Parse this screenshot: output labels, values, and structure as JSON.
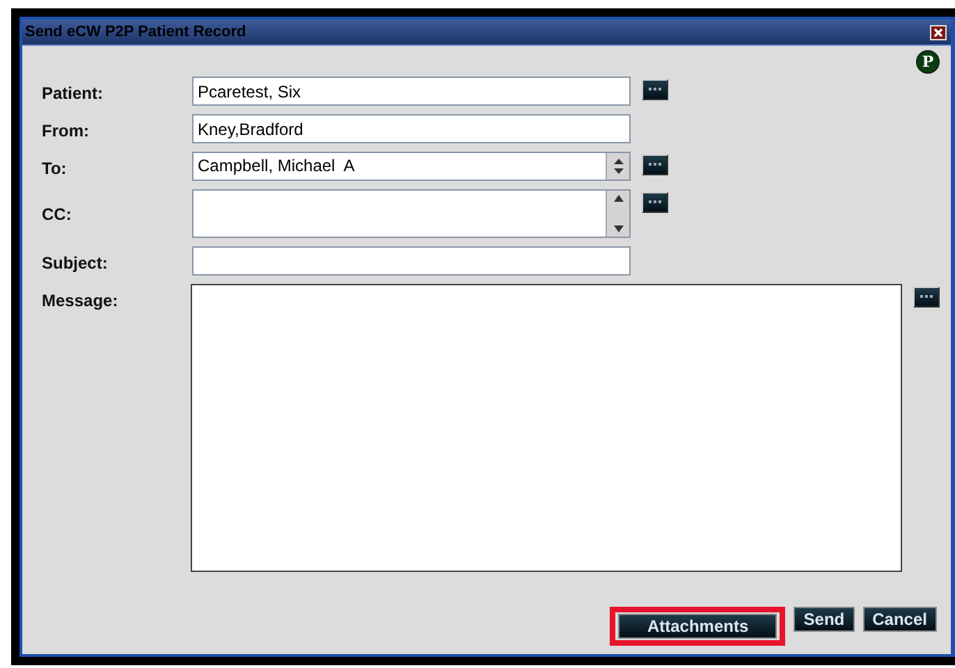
{
  "window": {
    "title": "Send eCW P2P Patient Record",
    "badge": "P"
  },
  "fields": [
    {
      "label": "Patient:",
      "kind": "text",
      "value": "Pcaretest, Six",
      "browse": true
    },
    {
      "label": "From:",
      "kind": "text",
      "value": "Kney,Bradford",
      "browse": false
    },
    {
      "label": "To:",
      "kind": "spinner",
      "value": "Campbell, Michael  A",
      "browse": true
    },
    {
      "label": "CC:",
      "kind": "list",
      "browse": true
    },
    {
      "label": "Subject:",
      "kind": "text",
      "browse": false
    },
    {
      "label": "Message:",
      "kind": "message",
      "browse": true
    }
  ],
  "buttons": [
    {
      "label": "Attachments",
      "highlighted": true
    },
    {
      "label": "Send",
      "highlighted": false
    },
    {
      "label": "Cancel",
      "highlighted": false
    }
  ]
}
